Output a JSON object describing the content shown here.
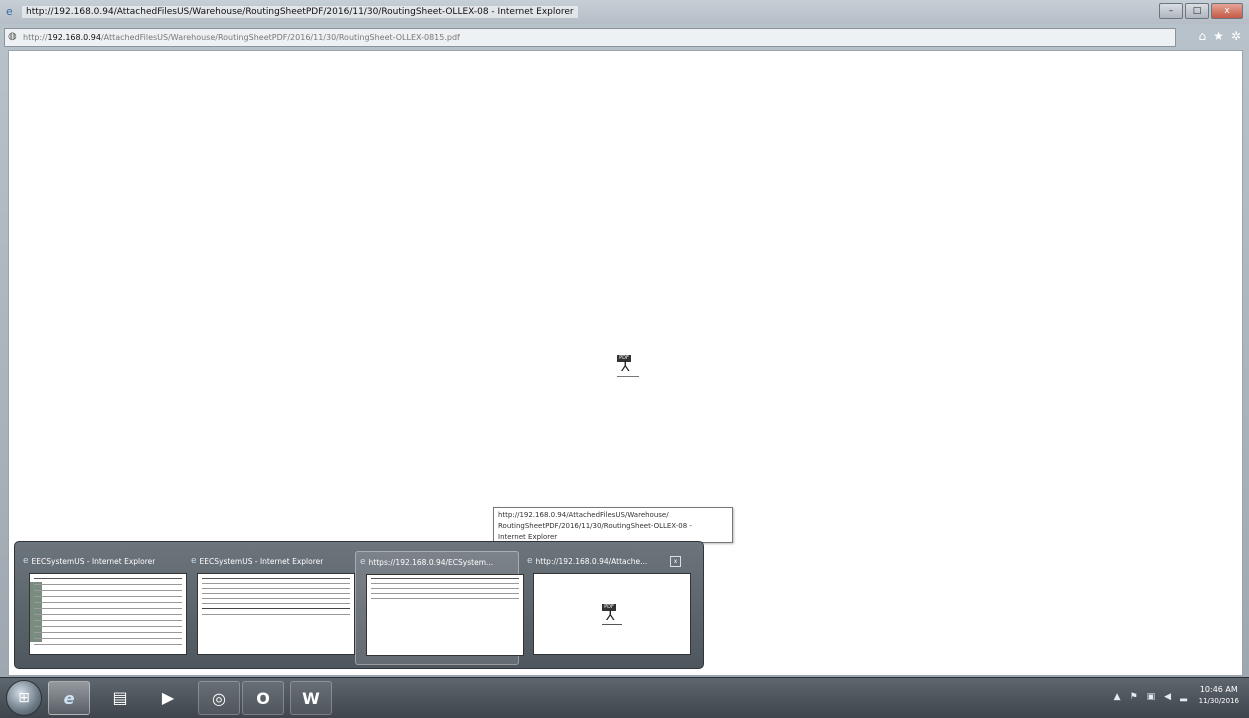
{
  "window": {
    "title": "http://192.168.0.94/AttachedFilesUS/Warehouse/RoutingSheetPDF/2016/11/30/RoutingSheet-OLLEX-08 - Internet Explorer",
    "controls": {
      "minimize": "–",
      "maximize": "□",
      "close": "x"
    }
  },
  "address_bar": {
    "url_prefix": "http://",
    "url_host": "192.168.0.94",
    "url_path": "/AttachedFilesUS/Warehouse/RoutingSheetPDF/2016/11/30/RoutingSheet-OLLEX-0815.pdf"
  },
  "toolbar": {
    "home_icon": "home-icon",
    "favorites_icon": "star-icon",
    "tools_icon": "gear-icon"
  },
  "content": {
    "pdf_badge": "PDF"
  },
  "tooltip": {
    "line1": "http://192.168.0.94/AttachedFilesUS/Warehouse/",
    "line2": "RoutingSheetPDF/2016/11/30/RoutingSheet-OLLEX-08 -",
    "line3": "Internet Explorer"
  },
  "thumbnails": [
    {
      "label": "EECSystemUS - Internet Explorer",
      "kind": "sheet"
    },
    {
      "label": "EECSystemUS - Internet Explorer",
      "kind": "sheet"
    },
    {
      "label": "https://192.168.0.94/ECSystem...",
      "kind": "sheet"
    },
    {
      "label": "http://192.168.0.94/Attache...",
      "kind": "pdf",
      "pdf_badge": "PDF",
      "close": "x"
    }
  ],
  "taskbar": {
    "start_icon": "windows-orb-icon",
    "buttons": [
      {
        "name": "internet-explorer",
        "glyph": "e"
      },
      {
        "name": "file-explorer",
        "glyph": "▤"
      },
      {
        "name": "media-player",
        "glyph": "▶"
      },
      {
        "name": "chrome",
        "glyph": "◎"
      },
      {
        "name": "outlook",
        "glyph": "O"
      },
      {
        "name": "word",
        "glyph": "W"
      }
    ],
    "tray": {
      "expand": "▲",
      "flag": "⚑",
      "network": "▣",
      "volume": "◀",
      "signal": "▂"
    },
    "clock": {
      "time": "10:46 AM",
      "date": "11/30/2016"
    }
  }
}
